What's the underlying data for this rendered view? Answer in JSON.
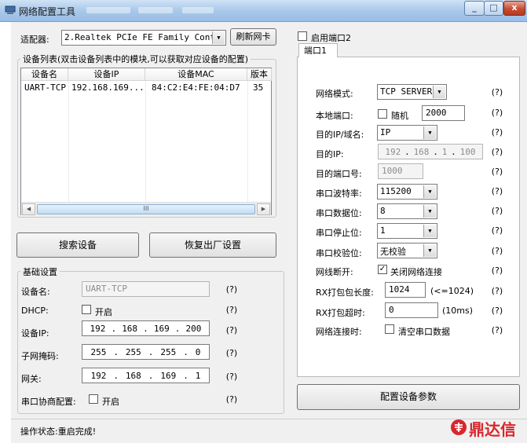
{
  "window": {
    "title": "网络配置工具",
    "controls": {
      "minimize": "_",
      "maximize": "□",
      "close": "x"
    }
  },
  "adapter": {
    "label": "适配器:",
    "selected": "2.Realtek PCIe FE Family Contr",
    "refresh_button": "刷新网卡"
  },
  "device_list": {
    "group_title": "设备列表(双击设备列表中的模块,可以获取对应设备的配置)",
    "columns": [
      "设备名",
      "设备IP",
      "设备MAC",
      "版本"
    ],
    "rows": [
      [
        "UART-TCP",
        "192.168.169...",
        "84:C2:E4:FE:04:D7",
        "35"
      ]
    ],
    "scroll_thumb": "III"
  },
  "actions": {
    "search_button": "搜索设备",
    "factory_reset_button": "恢复出厂设置",
    "configure_button": "配置设备参数"
  },
  "basic": {
    "group_title": "基础设置",
    "device_name_label": "设备名:",
    "device_name_value": "UART-TCP",
    "dhcp_label": "DHCP:",
    "dhcp_option": "开启",
    "device_ip_label": "设备IP:",
    "device_ip": [
      "192",
      "168",
      "169",
      "200"
    ],
    "subnet_label": "子网掩码:",
    "subnet": [
      "255",
      "255",
      "255",
      "0"
    ],
    "gateway_label": "网关:",
    "gateway": [
      "192",
      "168",
      "169",
      "1"
    ],
    "serial_negotiation_label": "串口协商配置:",
    "serial_negotiation_option": "开启",
    "help": "(?)"
  },
  "port": {
    "enable_port2_label": "启用端口2",
    "tab_label": "端口1",
    "network_mode_label": "网络模式:",
    "network_mode_value": "TCP SERVER",
    "local_port_label": "本地端口:",
    "random_label": "随机",
    "local_port_value": "2000",
    "dest_type_label": "目的IP/域名:",
    "dest_type_value": "IP",
    "dest_ip_label": "目的IP:",
    "dest_ip": [
      "192",
      "168",
      "1",
      "100"
    ],
    "dest_port_label": "目的端口号:",
    "dest_port_value": "1000",
    "baud_label": "串口波特率:",
    "baud_value": "115200",
    "data_bits_label": "串口数据位:",
    "data_bits_value": "8",
    "stop_bits_label": "串口停止位:",
    "stop_bits_value": "1",
    "parity_label": "串口校验位:",
    "parity_value": "无校验",
    "net_disconnect_label": "网线断开:",
    "close_net_label": "关闭网络连接",
    "rx_len_label": "RX打包包长度:",
    "rx_len_value": "1024",
    "rx_len_hint": "(<=1024)",
    "rx_timeout_label": "RX打包超时:",
    "rx_timeout_value": "0",
    "rx_timeout_hint": "(10ms)",
    "net_connect_label": "网络连接时:",
    "clear_serial_label": "清空串口数据",
    "help": "(?)",
    "check_mark": "✓"
  },
  "status": {
    "text": "操作状态:重启完成!"
  },
  "watermark": {
    "text": "鼎达信",
    "color": "#d8262c"
  }
}
